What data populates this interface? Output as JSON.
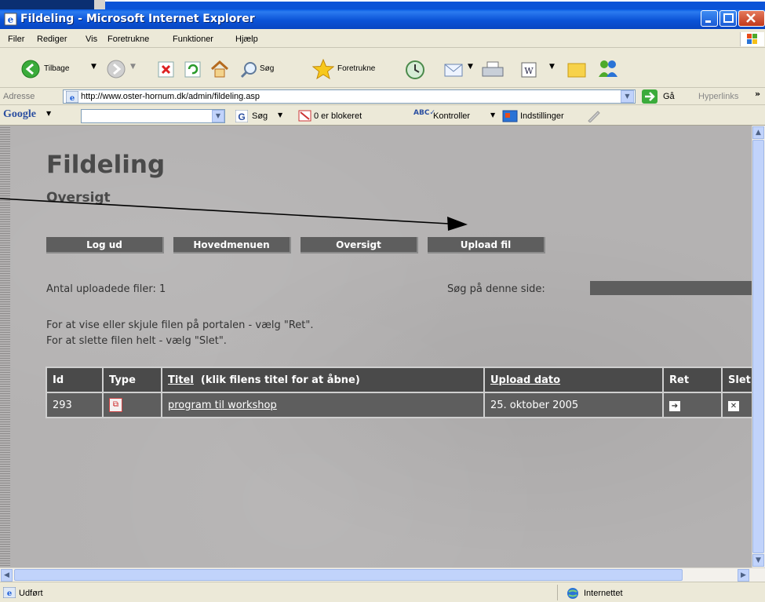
{
  "window": {
    "title": "Fildeling - Microsoft Internet Explorer"
  },
  "menu": [
    "Filer",
    "Rediger",
    "Vis",
    "Foretrukne",
    "Funktioner",
    "Hjælp"
  ],
  "toolbar": {
    "back_label": "Tilbage",
    "search_label": "Søg",
    "favorites_label": "Foretrukne"
  },
  "address": {
    "label": "Adresse",
    "url": "http://www.oster-hornum.dk/admin/fildeling.asp",
    "go_label": "Gå",
    "links_label": "Hyperlinks"
  },
  "google_bar": {
    "logo": "Google",
    "search_label": "Søg",
    "blocked_label": "0 er blokeret",
    "check_label": "Kontroller",
    "settings_label": "Indstillinger"
  },
  "page": {
    "title": "Fildeling",
    "subtitle": "Oversigt",
    "nav": {
      "logout": "Log ud",
      "main_menu": "Hovedmenuen",
      "overview": "Oversigt",
      "upload": "Upload fil"
    },
    "uploaded_count_text": "Antal uploadede filer: 1",
    "search_label": "Søg på denne side:",
    "instruction_1": "For at vise eller skjule filen på portalen - vælg \"Ret\".",
    "instruction_2": "For at slette filen helt - vælg \"Slet\".",
    "table": {
      "headers": {
        "id": "Id",
        "type": "Type",
        "title_link": "Titel",
        "title_hint": "(klik filens titel for at åbne)",
        "upload_date": "Upload dato",
        "edit": "Ret",
        "delete": "Slet"
      },
      "rows": [
        {
          "id": "293",
          "type_icon": "pdf-icon",
          "title": "program til workshop",
          "upload_date": "25. oktober 2005"
        }
      ]
    }
  },
  "status": {
    "left": "Udført",
    "zone": "Internettet"
  },
  "colors": {
    "titlebar": "#0b53d7",
    "content_bg": "#b4b2b2",
    "button_bg": "#5e5e5e",
    "table_header": "#4a4a4a"
  }
}
